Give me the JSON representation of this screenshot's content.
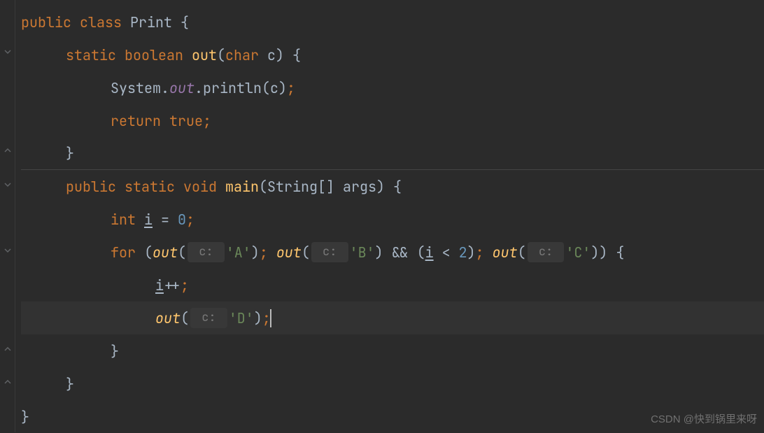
{
  "code": {
    "line1": {
      "kw_public": "public",
      "kw_class": "class",
      "classname": "Print",
      "brace": " {"
    },
    "line2": {
      "kw_static": "static",
      "kw_boolean": "boolean",
      "method": "out",
      "paren_open": "(",
      "kw_char": "char",
      "param": " c",
      "paren_close_brace": ") {"
    },
    "line3": {
      "text_system": "System.",
      "field_out": "out",
      "text_println": ".println(c)",
      "semi": ";"
    },
    "line4": {
      "kw_return": "return",
      "kw_true": " true",
      "semi": ";"
    },
    "line5": {
      "brace": "}"
    },
    "line6": {
      "kw_public": "public",
      "kw_static": "static",
      "kw_void": "void",
      "method": "main",
      "params": "(String[] args) {"
    },
    "line7": {
      "kw_int": "int",
      "var_i": "i",
      "eq": " = ",
      "num": "0",
      "semi": ";"
    },
    "line8": {
      "kw_for": "for",
      "paren_open": " (",
      "method_out1": "out",
      "p1": "(",
      "hint1": " c: ",
      "str_a": "'A'",
      "close1": ")",
      "semi1": "; ",
      "method_out2": "out",
      "p2": "(",
      "hint2": " c: ",
      "str_b": "'B'",
      "close2": ") && (",
      "var_i": "i",
      "cond": " < ",
      "num2": "2",
      "close_cond": ")",
      "semi2": "; ",
      "method_out3": "out",
      "p3": "(",
      "hint3": " c: ",
      "str_c": "'C'",
      "close3": ")) {"
    },
    "line9": {
      "var_i": "i",
      "op": "++",
      "semi": ";"
    },
    "line10": {
      "method_out": "out",
      "p1": "(",
      "hint": " c: ",
      "str_d": "'D'",
      "close": ")",
      "semi": ";"
    },
    "line11": {
      "brace": "}"
    },
    "line12": {
      "brace": "}"
    },
    "line13": {
      "brace": "}"
    }
  },
  "watermark": "CSDN @快到锅里来呀",
  "fold_positions": [
    {
      "line": 2,
      "type": "minus"
    },
    {
      "line": 5,
      "type": "up"
    },
    {
      "line": 6,
      "type": "minus"
    },
    {
      "line": 8,
      "type": "minus"
    },
    {
      "line": 11,
      "type": "up"
    },
    {
      "line": 12,
      "type": "up"
    }
  ]
}
